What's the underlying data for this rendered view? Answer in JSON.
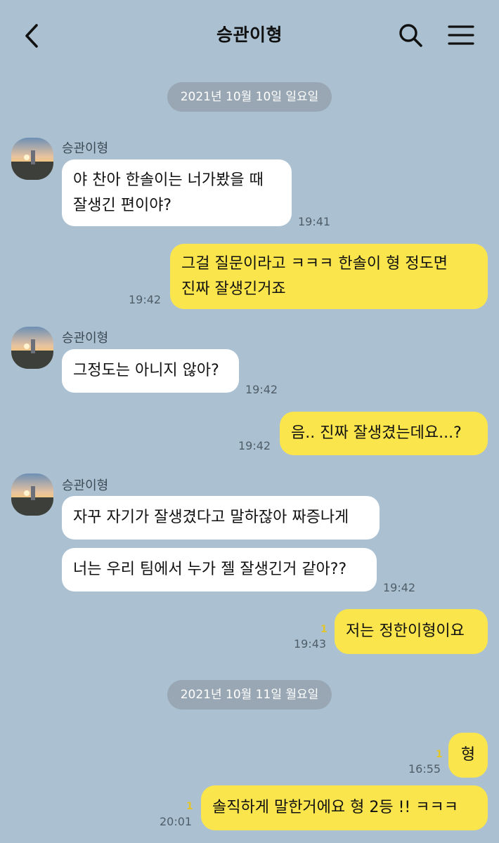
{
  "header": {
    "title": "승관이형",
    "back_icon": "chevron-left-icon",
    "search_icon": "search-icon",
    "menu_icon": "hamburger-menu-icon"
  },
  "colors": {
    "background": "#abc1d1",
    "bubble_outgoing": "#fbe54d",
    "bubble_incoming": "#ffffff",
    "date_separator": "#98a7b3",
    "unread_count": "#e3c52a"
  },
  "chat": {
    "date_1": "2021년 10월 10일 일요일",
    "date_2": "2021년 10월 11일 월요일",
    "messages": [
      {
        "direction": "in",
        "sender": "승관이형",
        "text": "야 찬아 한솔이는 너가봤을 때\n잘생긴 편이야?",
        "time": "19:41"
      },
      {
        "direction": "out",
        "text": "그걸 질문이라고 ㅋㅋㅋ 한솔이 형 정도면\n진짜 잘생긴거죠",
        "time": "19:42"
      },
      {
        "direction": "in",
        "sender": "승관이형",
        "text": "그정도는 아니지 않아?",
        "time": "19:42"
      },
      {
        "direction": "out",
        "text": "음.. 진짜 잘생겼는데요...?",
        "time": "19:42"
      },
      {
        "direction": "in",
        "sender": "승관이형",
        "text": "자꾸 자기가 잘생겼다고 말하잖아 짜증나게"
      },
      {
        "direction": "in",
        "text": "너는 우리 팀에서 누가 젤 잘생긴거 같아??",
        "time": "19:42"
      },
      {
        "direction": "out",
        "text": "저는 정한이형이요",
        "time": "19:43",
        "unread": "1"
      },
      {
        "direction": "out",
        "text": "형",
        "time": "16:55",
        "unread": "1"
      },
      {
        "direction": "out",
        "text": "솔직하게 말한거에요 형 2등 !! ㅋㅋㅋ",
        "time": "20:01",
        "unread": "1"
      }
    ]
  }
}
